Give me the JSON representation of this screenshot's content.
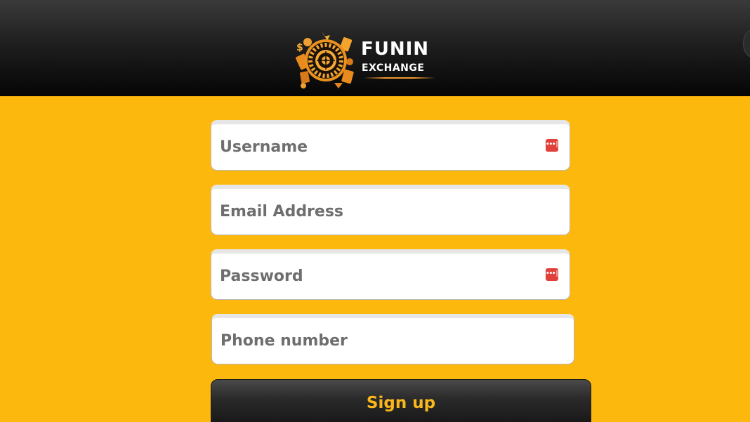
{
  "header": {
    "logo": {
      "brand_main": "FUNIN",
      "brand_sub": "EXCHANGE"
    }
  },
  "form": {
    "username": {
      "placeholder": "Username",
      "value": ""
    },
    "email": {
      "placeholder": "Email Address",
      "value": ""
    },
    "password": {
      "placeholder": "Password",
      "value": ""
    },
    "phone": {
      "placeholder": "Phone number",
      "value": ""
    },
    "signup_label": "Sign up"
  },
  "icons": {
    "username_field_icon": "password-manager-icon",
    "password_field_icon": "password-manager-icon"
  },
  "colors": {
    "background": "#FDB80E",
    "header": "#1a1a1a",
    "button_text": "#F9B71A",
    "field_icon": "#E0413B"
  }
}
